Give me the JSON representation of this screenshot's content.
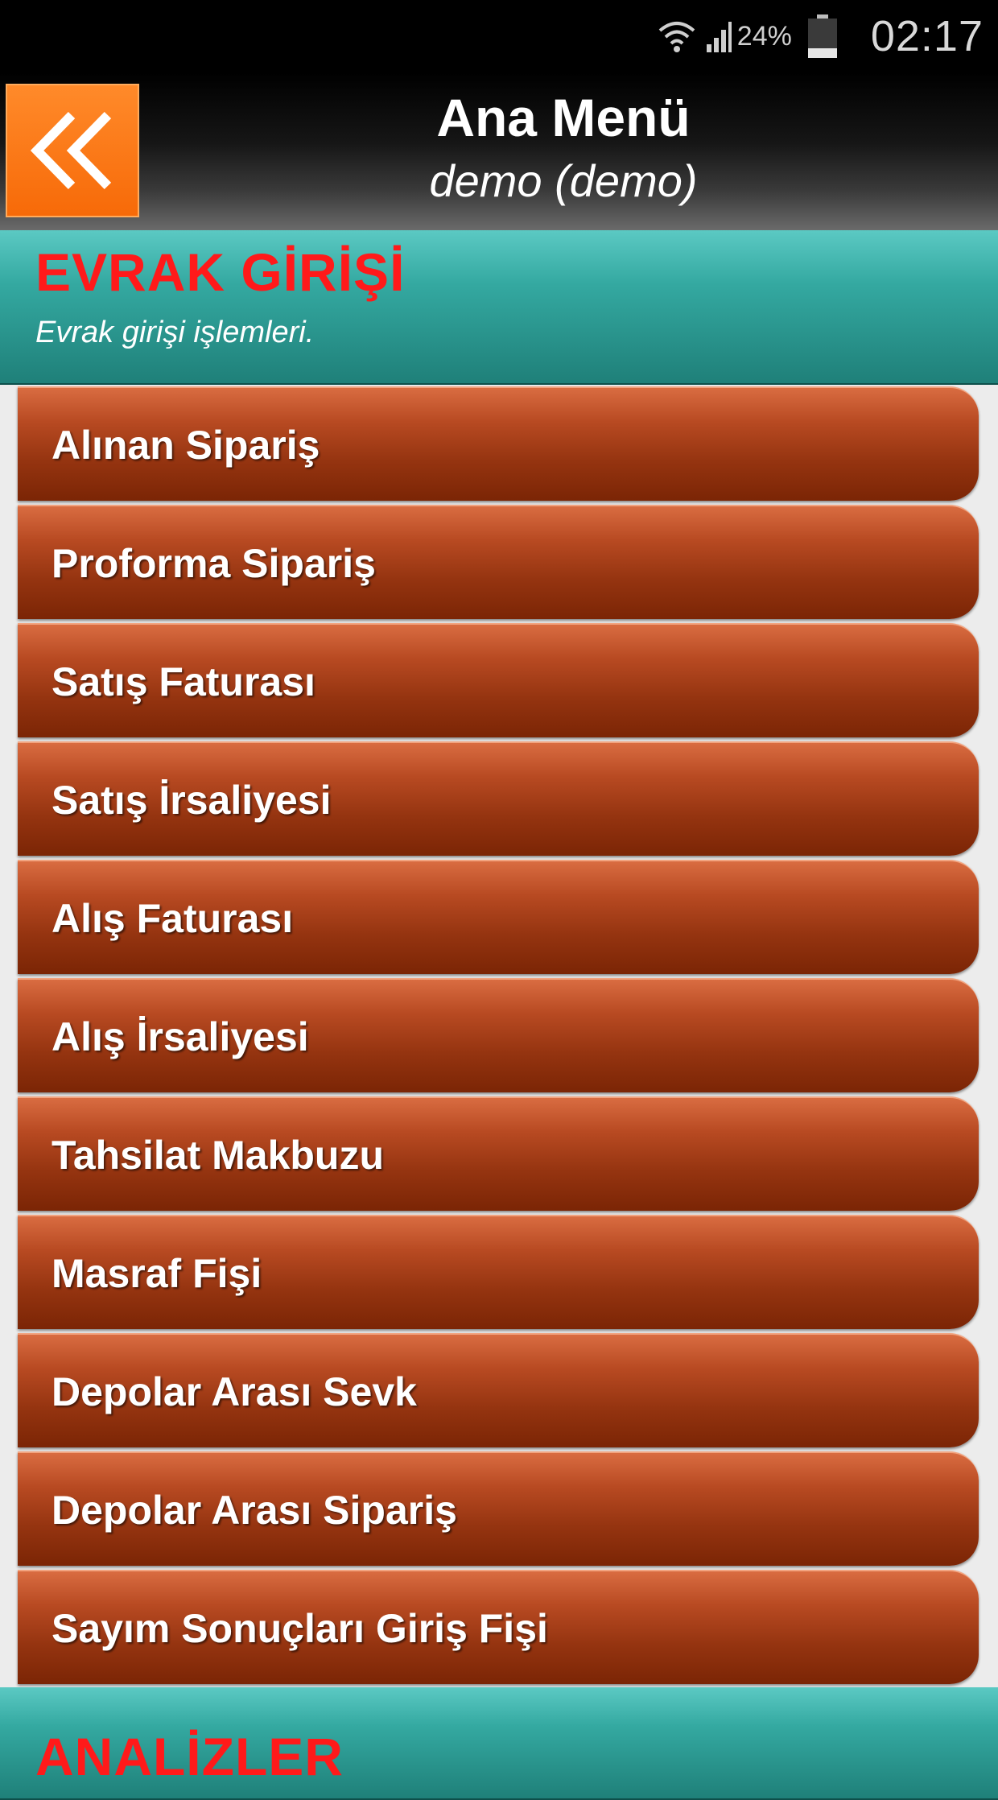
{
  "status_bar": {
    "battery_percent": "24%",
    "battery_level": 0.24,
    "time": "02:17",
    "icons": [
      "wifi-icon",
      "signal-icon",
      "battery-icon"
    ]
  },
  "header": {
    "back_icon": "double-chevron-left-icon",
    "title": "Ana Menü",
    "subtitle": "demo (demo)"
  },
  "colors": {
    "header_bg": "#000000",
    "back_button": "#f7730f",
    "section_bg": "#2f9f97",
    "section_title": "#ff1a1a",
    "menu_item_bg": "#a33d15"
  },
  "sections": [
    {
      "title": "EVRAK GİRİŞİ",
      "description": "Evrak girişi işlemleri.",
      "items": [
        {
          "label": "Alınan Sipariş"
        },
        {
          "label": "Proforma Sipariş"
        },
        {
          "label": "Satış Faturası"
        },
        {
          "label": "Satış İrsaliyesi"
        },
        {
          "label": "Alış Faturası"
        },
        {
          "label": "Alış İrsaliyesi"
        },
        {
          "label": "Tahsilat Makbuzu"
        },
        {
          "label": "Masraf Fişi"
        },
        {
          "label": "Depolar Arası Sevk"
        },
        {
          "label": "Depolar Arası Sipariş"
        },
        {
          "label": "Sayım Sonuçları Giriş Fişi"
        }
      ]
    },
    {
      "title": "ANALİZLER"
    }
  ]
}
